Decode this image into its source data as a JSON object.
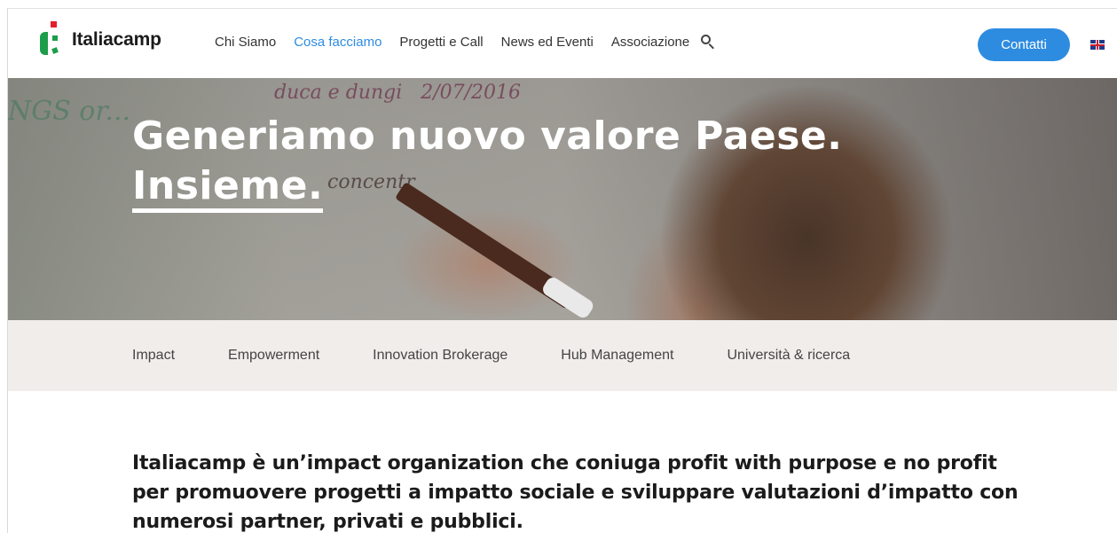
{
  "brand": {
    "name": "Italiacamp"
  },
  "nav": {
    "items": [
      {
        "label": "Chi Siamo",
        "active": false
      },
      {
        "label": "Cosa facciamo",
        "active": true
      },
      {
        "label": "Progetti e Call",
        "active": false
      },
      {
        "label": "News ed Eventi",
        "active": false
      },
      {
        "label": "Associazione",
        "active": false
      }
    ],
    "search_icon": "search-icon",
    "contact_label": "Contatti",
    "language_icon": "uk-flag-icon"
  },
  "hero": {
    "title_line1": "Generiamo nuovo valore Paese.",
    "title_line2": "Insieme."
  },
  "subnav": {
    "items": [
      {
        "label": "Impact"
      },
      {
        "label": "Empowerment"
      },
      {
        "label": "Innovation Brokerage"
      },
      {
        "label": "Hub Management"
      },
      {
        "label": "Università & ricerca"
      }
    ]
  },
  "intro": {
    "text": "Italiacamp è un’impact organization che coniuga profit with purpose e no profit per promuovere progetti a impatto sociale e sviluppare valutazioni d’impatto con numerosi partner, privati e pubblici."
  },
  "colors": {
    "accent": "#2d8ce0",
    "brand_green": "#1d9d4a",
    "brand_red": "#e3202b",
    "subnav_bg": "#f1edeb"
  }
}
